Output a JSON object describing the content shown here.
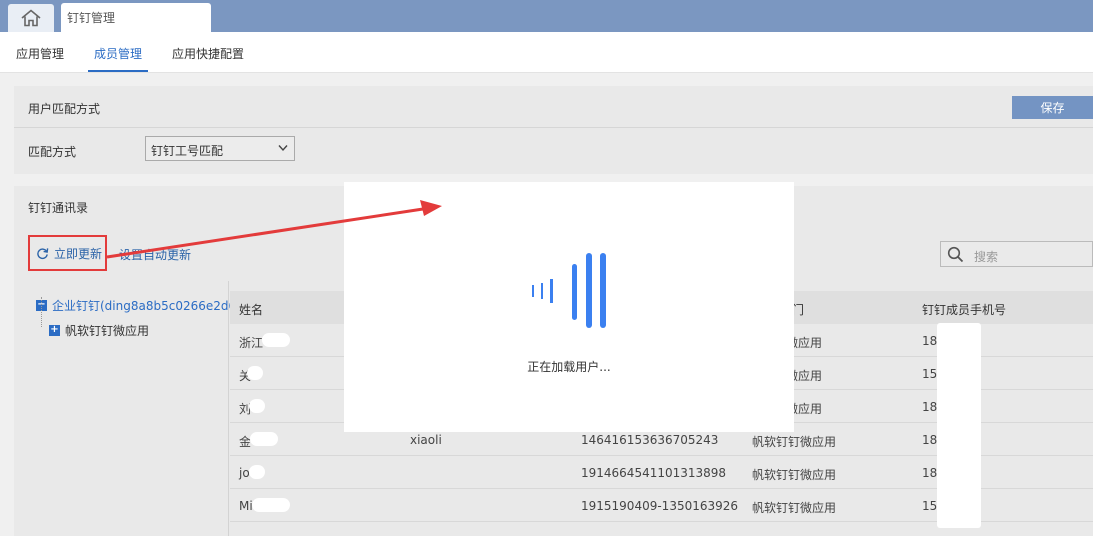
{
  "tabs": {
    "home_icon": "home-icon",
    "doc_tab": "钉钉管理"
  },
  "subnav": {
    "items": [
      "应用管理",
      "成员管理",
      "应用快捷配置"
    ],
    "active_index": 1
  },
  "match_section": {
    "title": "用户匹配方式",
    "save_label": "保存",
    "match_label": "匹配方式",
    "match_value": "钉钉工号匹配"
  },
  "directory": {
    "title": "钉钉通讯录",
    "refresh_label": "立即更新",
    "auto_update_label": "设置自动更新",
    "search_placeholder": "搜索",
    "tree": {
      "root": "企业钉钉(ding8a8b5c0266e2d68",
      "child": "帆软钉钉微应用"
    }
  },
  "table": {
    "headers": [
      "姓名",
      "",
      "",
      "门",
      "钉钉成员手机号"
    ],
    "rows": [
      {
        "name": "浙江",
        "user": "",
        "id": "",
        "dept": "钉钉微应用",
        "phone": "18 03"
      },
      {
        "name": "关",
        "user": "",
        "id": "",
        "dept": "钉钉微应用",
        "phone": "15 67"
      },
      {
        "name": "刘",
        "user": "",
        "id": "",
        "dept": "钉钉微应用",
        "phone": "18 12"
      },
      {
        "name": "金",
        "user": "xiaoli",
        "id": "146416153636705243",
        "dept": "帆软钉钉微应用",
        "phone": "18 25"
      },
      {
        "name": "jo",
        "user": "",
        "id": "1914664541101313898",
        "dept": "帆软钉钉微应用",
        "phone": "18 83"
      },
      {
        "name": "Mi",
        "user": "",
        "id": "1915190409-1350163926",
        "dept": "帆软钉钉微应用",
        "phone": "15 47"
      }
    ]
  },
  "modal": {
    "loading_text": "正在加载用户..."
  },
  "colors": {
    "accent": "#2b6cc4",
    "highlight_red": "#e33b3b",
    "topbar": "#7b97c1"
  }
}
